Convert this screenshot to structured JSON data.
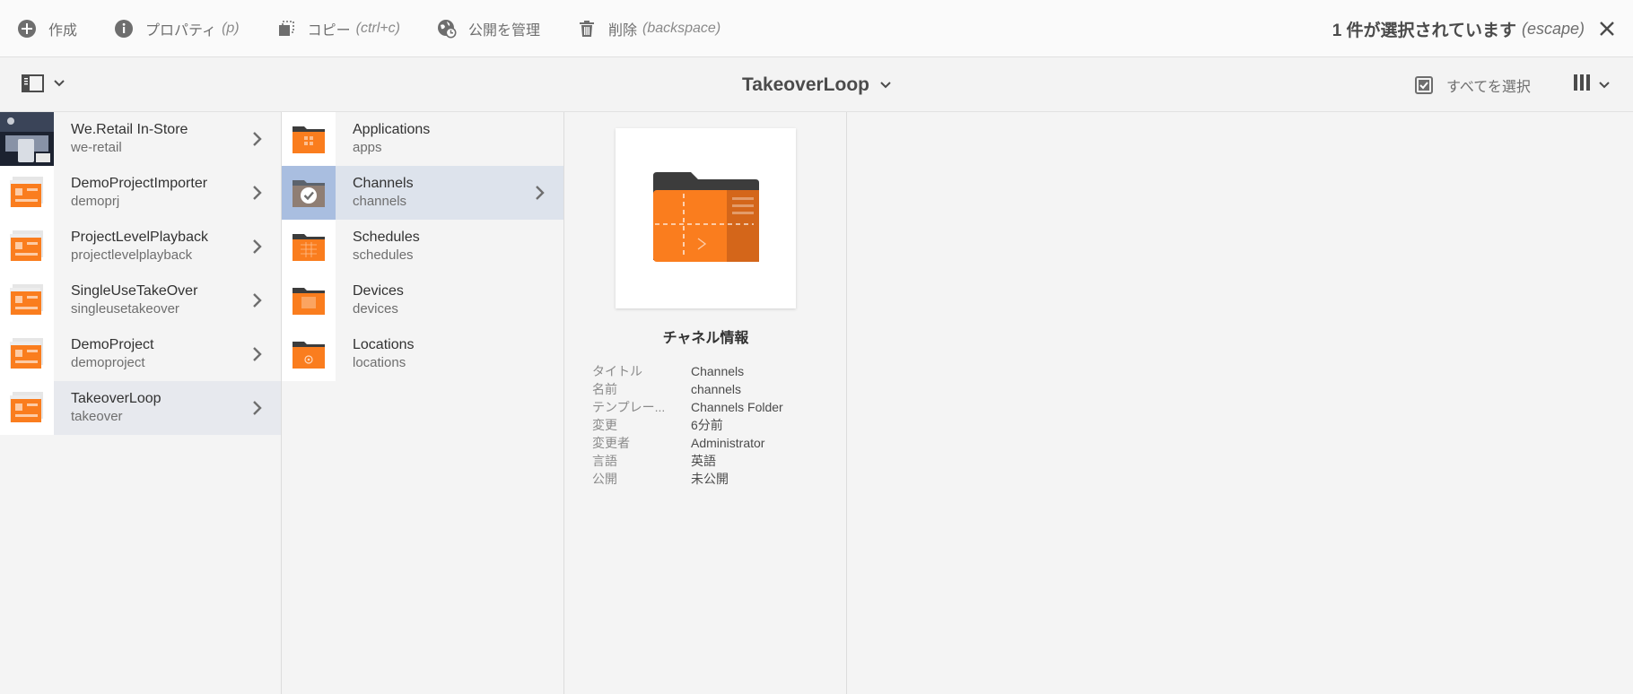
{
  "actionbar": {
    "create": {
      "label": "作成",
      "icon": "add-circle-icon"
    },
    "properties": {
      "label": "プロパティ",
      "shortcut": "(p)",
      "icon": "info-icon"
    },
    "copy": {
      "label": "コピー",
      "shortcut": "(ctrl+c)",
      "icon": "copy-icon"
    },
    "publish": {
      "label": "公開を管理",
      "icon": "globe-clock-icon"
    },
    "delete": {
      "label": "削除",
      "shortcut": "(backspace)",
      "icon": "trash-icon"
    },
    "selection_text": "1 件が選択されています",
    "selection_shortcut": "(escape)"
  },
  "titlebar": {
    "title": "TakeoverLoop",
    "select_all": "すべてを選択"
  },
  "column1": [
    {
      "title": "We.Retail In-Store",
      "subtitle": "we-retail",
      "thumb": "photo"
    },
    {
      "title": "DemoProjectImporter",
      "subtitle": "demoprj",
      "thumb": "project"
    },
    {
      "title": "ProjectLevelPlayback",
      "subtitle": "projectlevelplayback",
      "thumb": "project"
    },
    {
      "title": "SingleUseTakeOver",
      "subtitle": "singleusetakeover",
      "thumb": "project"
    },
    {
      "title": "DemoProject",
      "subtitle": "demoproject",
      "thumb": "project"
    },
    {
      "title": "TakeoverLoop",
      "subtitle": "takeover",
      "thumb": "project",
      "active": true
    }
  ],
  "column2": [
    {
      "title": "Applications",
      "subtitle": "apps",
      "icon": "applications-folder-icon"
    },
    {
      "title": "Channels",
      "subtitle": "channels",
      "icon": "channels-folder-icon",
      "selected": true
    },
    {
      "title": "Schedules",
      "subtitle": "schedules",
      "icon": "schedules-folder-icon"
    },
    {
      "title": "Devices",
      "subtitle": "devices",
      "icon": "devices-folder-icon"
    },
    {
      "title": "Locations",
      "subtitle": "locations",
      "icon": "locations-folder-icon"
    }
  ],
  "preview": {
    "heading": "チャネル情報",
    "meta": [
      {
        "key": "タイトル",
        "value": "Channels"
      },
      {
        "key": "名前",
        "value": "channels"
      },
      {
        "key": "テンプレー...",
        "value": "Channels Folder"
      },
      {
        "key": "変更",
        "value": "6分前"
      },
      {
        "key": "変更者",
        "value": "Administrator"
      },
      {
        "key": "言語",
        "value": "英語"
      },
      {
        "key": "公開",
        "value": "未公開"
      }
    ]
  },
  "colors": {
    "accent_orange": "#fa7d1e",
    "selection_blue": "#2680eb",
    "folder_dark": "#3c3c3c"
  }
}
